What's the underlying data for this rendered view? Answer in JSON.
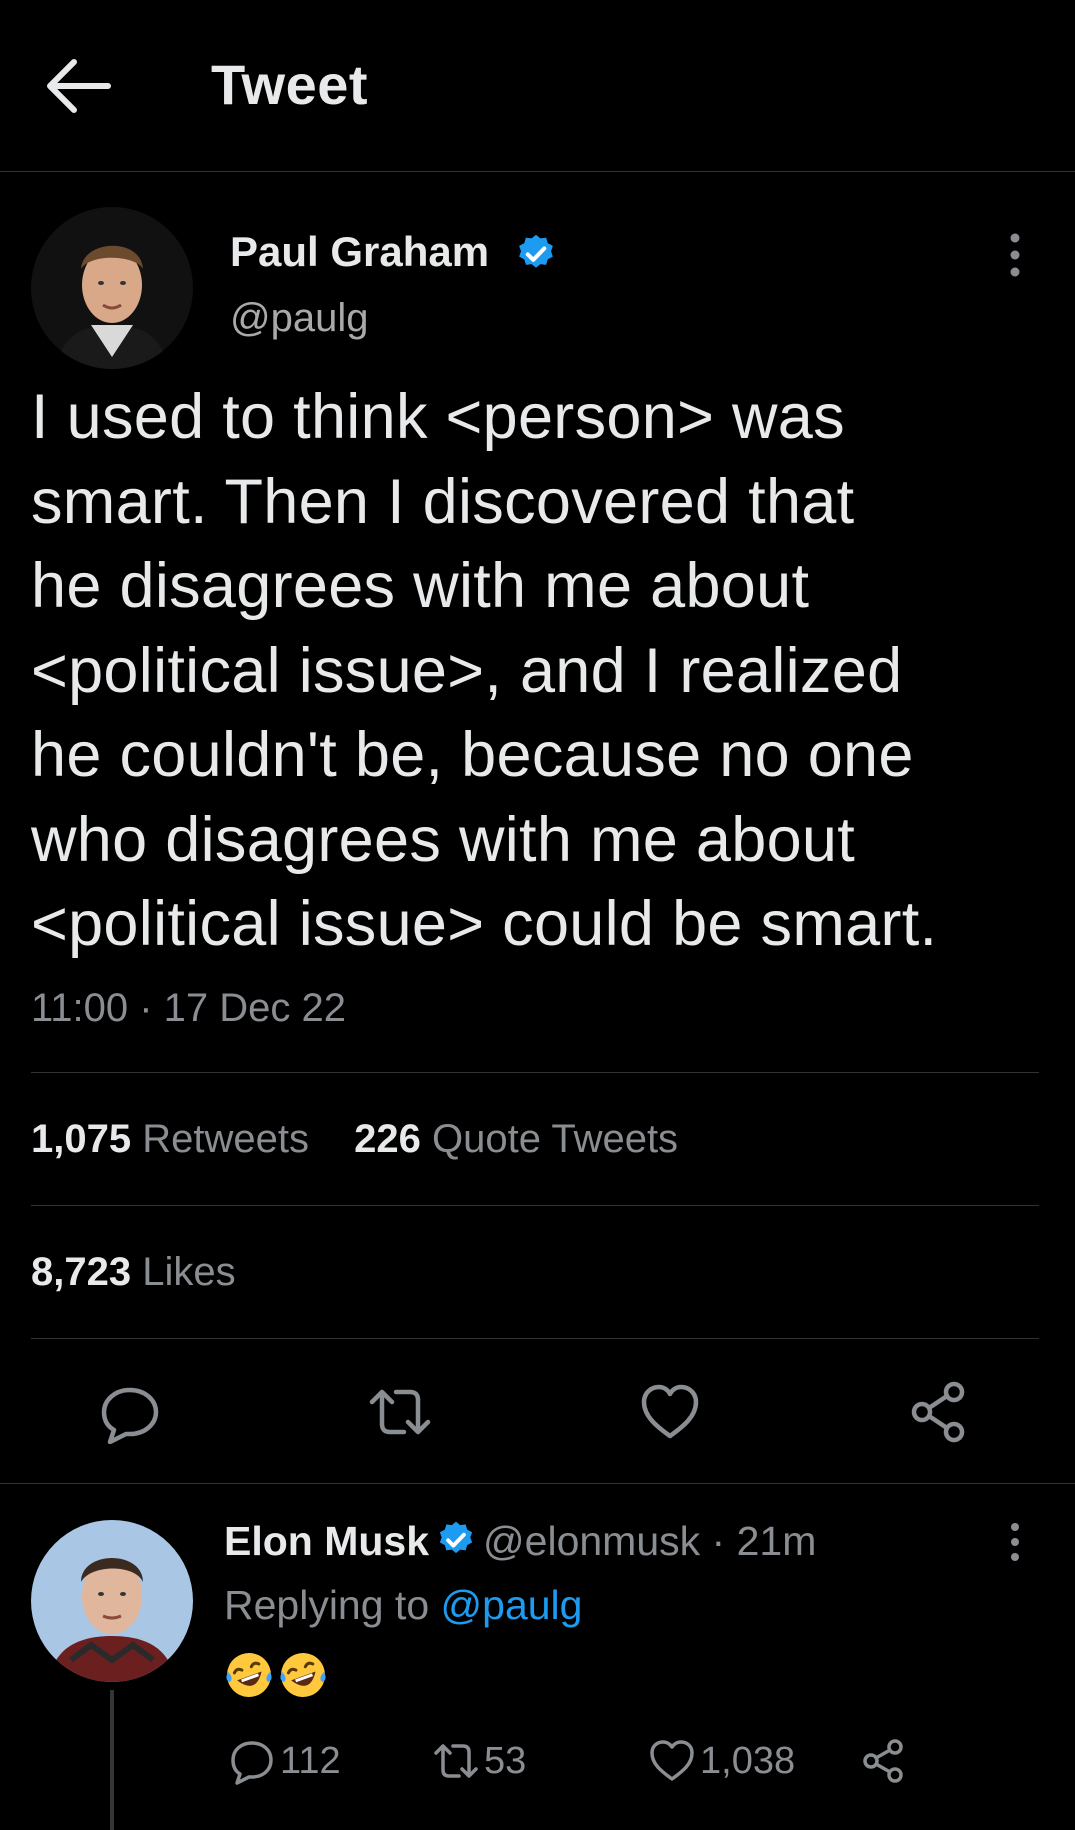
{
  "header": {
    "title": "Tweet"
  },
  "tweet": {
    "author_name": "Paul Graham",
    "author_handle": "@paulg",
    "text": "I used to think <person> was\nsmart. Then I discovered that\nhe disagrees with me about\n<political issue>, and I realized\nhe couldn't be, because no one\nwho disagrees with me about\n<political issue> could be smart.",
    "time": "11:00 · 17 Dec 22",
    "retweets_count": "1,075",
    "retweets_label": "Retweets",
    "quotes_count": "226",
    "quotes_label": "Quote Tweets",
    "likes_count": "8,723",
    "likes_label": "Likes"
  },
  "reply": {
    "author_name": "Elon Musk",
    "author_handle": "@elonmusk",
    "separator": "·",
    "age": "21m",
    "replying_prefix": "Replying to",
    "replying_to": "@paulg",
    "emoji": "🤣🤣",
    "reply_count": "112",
    "retweet_count": "53",
    "like_count": "1,038"
  },
  "colors": {
    "background": "#000000",
    "text": "#e7e9ea",
    "secondary": "#8a8d91",
    "accent": "#1d9bf0",
    "divider": "#2f3336"
  },
  "icons": [
    "back-arrow-icon",
    "verified-badge-icon",
    "more-options-icon",
    "reply-icon",
    "retweet-icon",
    "like-icon",
    "share-icon",
    "laughing-emoji"
  ]
}
